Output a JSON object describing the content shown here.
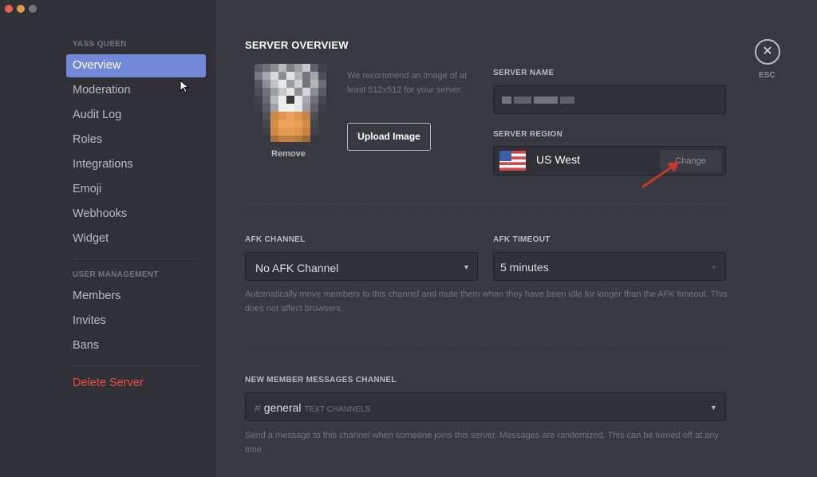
{
  "colors": {
    "accent": "#7289da",
    "danger": "#f04747",
    "background": "#36393f",
    "sidebar": "#2f3136"
  },
  "sidebar": {
    "server_header": "YASS QUEEN",
    "items": [
      {
        "label": "Overview",
        "active": true
      },
      {
        "label": "Moderation"
      },
      {
        "label": "Audit Log"
      },
      {
        "label": "Roles"
      },
      {
        "label": "Integrations"
      },
      {
        "label": "Emoji"
      },
      {
        "label": "Webhooks"
      },
      {
        "label": "Widget"
      }
    ],
    "user_management_header": "USER MANAGEMENT",
    "user_items": [
      {
        "label": "Members"
      },
      {
        "label": "Invites"
      },
      {
        "label": "Bans"
      }
    ],
    "delete_label": "Delete Server"
  },
  "overview": {
    "title": "SERVER OVERVIEW",
    "icon_hint": "We recommend an image of at least 512x512 for your server.",
    "upload_label": "Upload Image",
    "remove_label": "Remove",
    "server_name_label": "SERVER NAME",
    "server_region_label": "SERVER REGION",
    "region": "US West",
    "change_label": "Change"
  },
  "afk": {
    "channel_label": "AFK CHANNEL",
    "channel_value": "No AFK Channel",
    "timeout_label": "AFK TIMEOUT",
    "timeout_value": "5 minutes",
    "note": "Automatically move members to this channel and mute them when they have been idle for longer than the AFK timeout. This does not affect browsers."
  },
  "new_member": {
    "label": "NEW MEMBER MESSAGES CHANNEL",
    "hash": "#",
    "channel": "general",
    "channel_type": "TEXT CHANNELS",
    "note": "Send a message to this channel when someone joins this server. Messages are randomized. This can be turned off at any time."
  },
  "close": {
    "icon": "close-icon",
    "symbol": "✕",
    "label": "ESC"
  }
}
